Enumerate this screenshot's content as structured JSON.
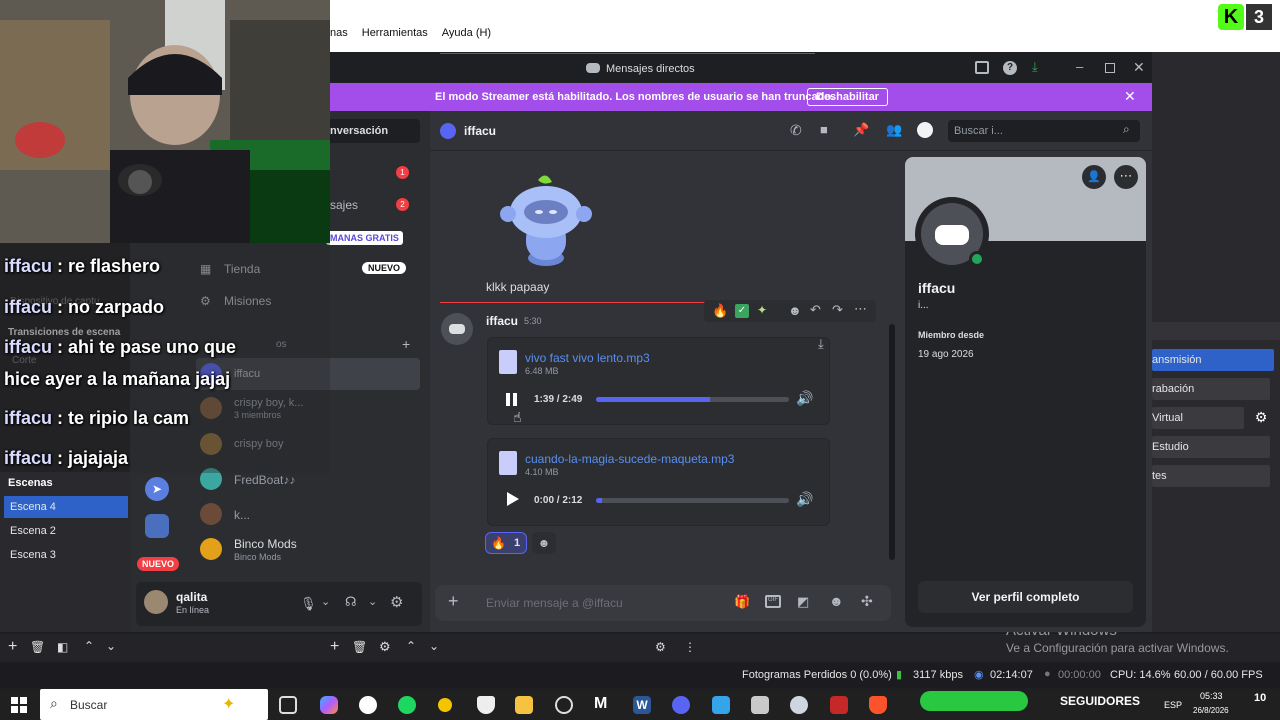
{
  "obs": {
    "menu": [
      "nas",
      "Herramientas",
      "Ayuda (H)"
    ],
    "side_labels": [
      "Dispositivo de captu",
      "Transiciones de escena",
      "Corte"
    ],
    "controls": [
      "ansmisión",
      "rabación",
      "Virtual",
      "Estudio",
      "tes"
    ],
    "scenes_header": "Escenas",
    "scenes": [
      "Escena 4",
      "Escena 2",
      "Escena 3"
    ],
    "watermark_title": "Activar Windows",
    "watermark_sub": "Ve a Configuración para activar Windows.",
    "status": {
      "frames_lost": "Fotogramas Perdidos 0 (0.0%)",
      "bitrate": "3117 kbps",
      "stream_time": "02:14:07",
      "rec_time": "00:00:00",
      "cpu": "CPU: 14.6%",
      "fps": "60.00 / 60.00 FPS"
    }
  },
  "discord": {
    "title": "Mensajes directos",
    "banner_text": "El modo Streamer está habilitado. Los nombres de usuario se han truncado.",
    "banner_button": "Deshabilitar",
    "sidebar": {
      "header": "nversación",
      "badge_1": "1",
      "messages_label": "sajes",
      "badge_2": "2",
      "promo": "MANAS GRATIS",
      "store": "Tienda",
      "store_badge": "NUEVO",
      "missions": "Misiones",
      "dm_label": "os",
      "dms": [
        {
          "name": "iffacu",
          "sub": ""
        },
        {
          "name": "crispy boy, k...",
          "sub": "3 miembros"
        },
        {
          "name": "crispy boy",
          "sub": ""
        },
        {
          "name": "FredBoat♪♪",
          "sub": ""
        },
        {
          "name": "k...",
          "sub": ""
        },
        {
          "name": "Binco Mods",
          "sub": "Binco Mods"
        }
      ],
      "guild_badge": "NUEVO",
      "user_name": "qalita",
      "user_status": "En línea"
    },
    "chat": {
      "channel": "iffacu",
      "search_placeholder": "Buscar i...",
      "prev_message": "klkk papaay",
      "author": "iffacu",
      "time": "5:30",
      "files": [
        {
          "name": "vivo fast vivo lento.mp3",
          "size": "6.48 MB",
          "time": "1:39 / 2:49",
          "progress": 0.59,
          "playing": true
        },
        {
          "name": "cuando-la-magia-sucede-maqueta.mp3",
          "size": "4.10 MB",
          "time": "0:00 / 2:12",
          "progress": 0.03,
          "playing": false
        }
      ],
      "reaction_count": "1",
      "input_placeholder": "Enviar mensaje a @iffacu"
    },
    "profile": {
      "name": "iffacu",
      "tag": "i...",
      "member_since_label": "Miembro desde",
      "member_since": "19 ago 2026",
      "full_profile_button": "Ver perfil completo"
    }
  },
  "stream_chat": [
    {
      "user": "iffacu",
      "text": "re flashero"
    },
    {
      "user": "iffacu",
      "text": "no zarpado"
    },
    {
      "user": "iffacu",
      "text": "ahi te pase uno que"
    },
    {
      "user": "",
      "text": "hice ayer a la mañana jajaj"
    },
    {
      "user": "iffacu",
      "text": "te ripio la cam"
    },
    {
      "user": "iffacu",
      "text": "jajajaja"
    }
  ],
  "taskbar": {
    "search": "Buscar",
    "followers": "SEGUIDORES",
    "lang": "ESP",
    "clock": "05:33",
    "date": "26/8/2026",
    "notif": "10"
  }
}
